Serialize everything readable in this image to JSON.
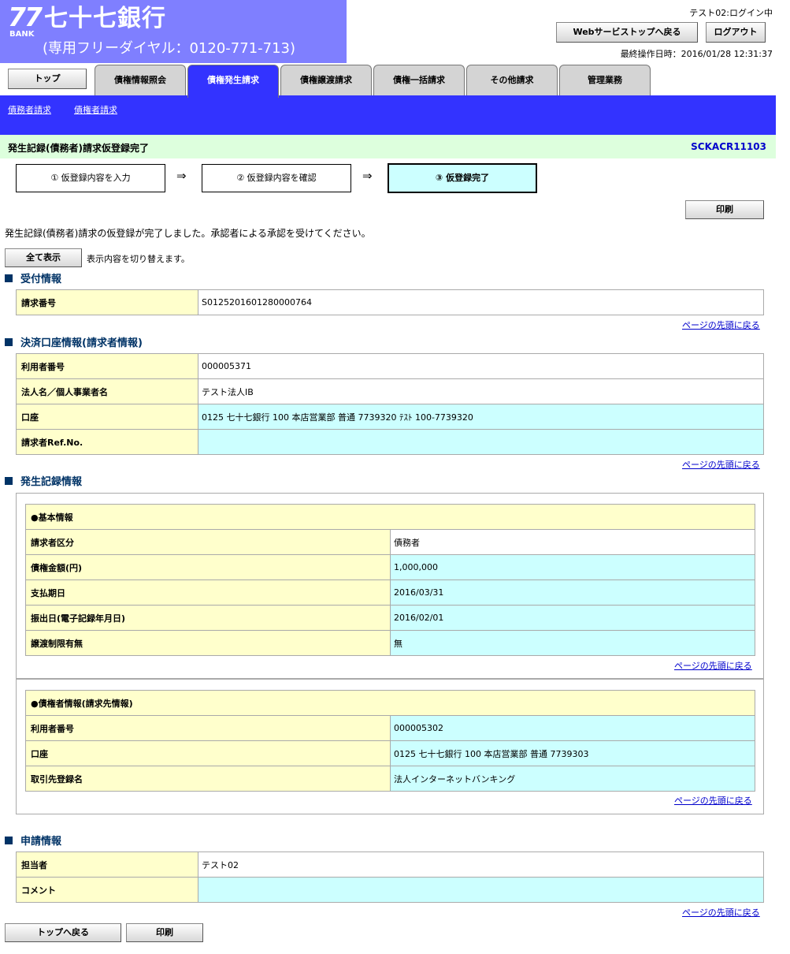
{
  "header": {
    "logo_number": "77",
    "logo_bank": "BANK",
    "bank_name": "七十七銀行",
    "dial": "(専用フリーダイヤル：0120-771-713)",
    "login_status": "テスト02:ログイン中",
    "web_top_button": "Webサービストップへ戻る",
    "logout_button": "ログアウト",
    "last_operation": "最終操作日時：2016/01/28 12:31:37"
  },
  "tabs": {
    "top": "トップ",
    "items": [
      "債権情報照会",
      "債権発生請求",
      "債権譲渡請求",
      "債権一括請求",
      "その他請求",
      "管理業務"
    ],
    "active_index": 1
  },
  "subnav": {
    "debtor_request": "債務者請求",
    "creditor_request": "債権者請求"
  },
  "page": {
    "title": "発生記録(債務者)請求仮登録完了",
    "screen_code": "SCKACR11103"
  },
  "steps": [
    "① 仮登録内容を入力",
    "② 仮登録内容を確認",
    "③ 仮登録完了"
  ],
  "arrow": "⇒",
  "buttons": {
    "print": "印刷",
    "show_all": "全て表示",
    "back_to_top": "トップへ戻る"
  },
  "message": "発生記録(債務者)請求の仮登録が完了しました。承認者による承認を受けてください。",
  "switch_note": "表示内容を切り替えます。",
  "page_top_link": "ページの先頭に戻る",
  "reception": {
    "heading": "受付情報",
    "request_no_label": "請求番号",
    "request_no": "S0125201601280000764"
  },
  "settlement": {
    "heading": "決済口座情報(請求者情報)",
    "user_no_label": "利用者番号",
    "user_no": "000005371",
    "corp_name_label": "法人名／個人事業者名",
    "corp_name": "テスト法人IB",
    "account_label": "口座",
    "account": "0125 七十七銀行 100 本店営業部 普通 7739320 ﾃｽﾄ 100-7739320",
    "ref_label": "請求者Ref.No.",
    "ref": ""
  },
  "record": {
    "heading": "発生記録情報",
    "basic": {
      "heading": "●基本情報",
      "requester_type_label": "請求者区分",
      "requester_type": "債務者",
      "amount_label": "債権金額(円)",
      "amount": "1,000,000",
      "due_date_label": "支払期日",
      "due_date": "2016/03/31",
      "issue_date_label": "振出日(電子記録年月日)",
      "issue_date": "2016/02/01",
      "transfer_limit_label": "譲渡制限有無",
      "transfer_limit": "無"
    },
    "creditor": {
      "heading": "●債権者情報(請求先情報)",
      "user_no_label": "利用者番号",
      "user_no": "000005302",
      "account_label": "口座",
      "account": "0125 七十七銀行 100 本店営業部 普通 7739303",
      "partner_label": "取引先登録名",
      "partner": "法人インターネットバンキング"
    }
  },
  "application": {
    "heading": "申請情報",
    "person_label": "担当者",
    "person": "テスト02",
    "comment_label": "コメント",
    "comment": ""
  }
}
